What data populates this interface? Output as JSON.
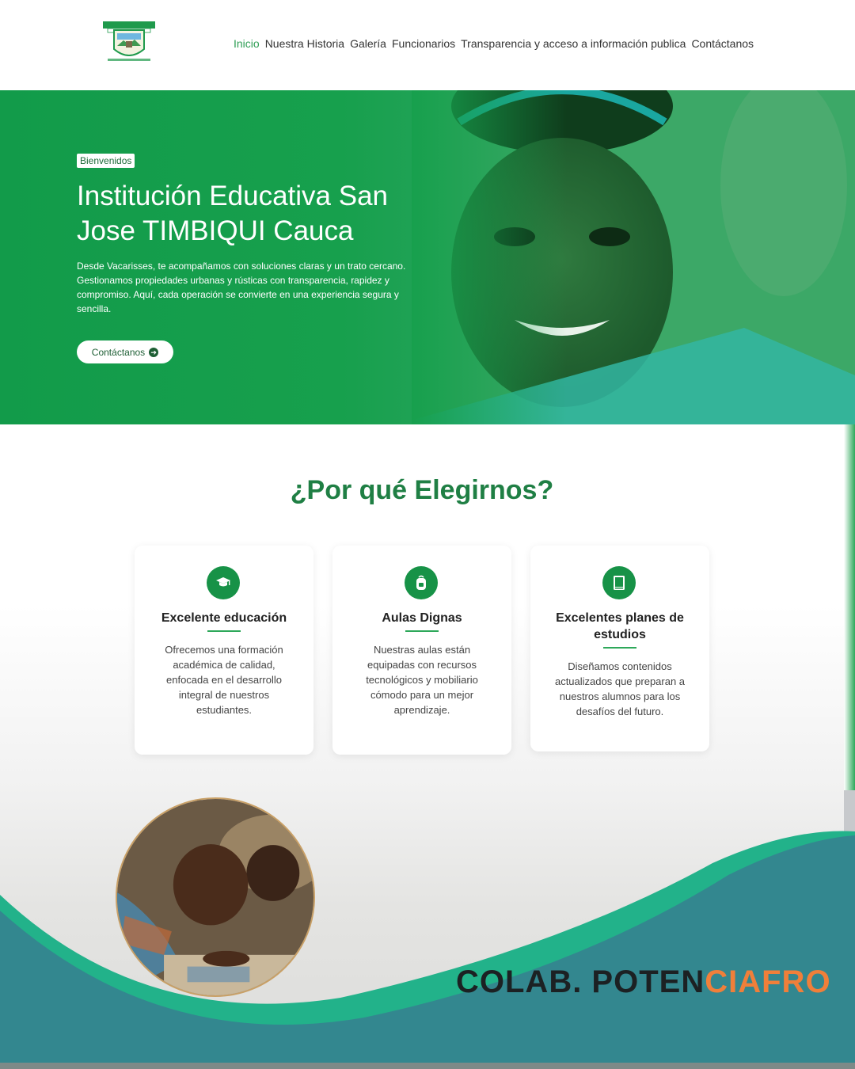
{
  "header": {
    "logo_alt": "Institución Educativa San José Timbiquí Cauca logo",
    "nav": [
      {
        "label": "Inicio",
        "active": true
      },
      {
        "label": "Nuestra Historia",
        "active": false
      },
      {
        "label": "Galería",
        "active": false
      },
      {
        "label": "Funcionarios",
        "active": false
      },
      {
        "label": "Transparencia y acceso a información publica",
        "active": false
      },
      {
        "label": "Contáctanos",
        "active": false
      }
    ]
  },
  "hero": {
    "badge": "Bienvenidos",
    "title_line1": "Institución Educativa San",
    "title_line2": "Jose TIMBIQUI Cauca",
    "description": "Desde Vacarisses, te acompañamos con soluciones claras y un trato cercano. Gestionamos propiedades urbanas y rústicas con transparencia, rapidez y compromiso. Aquí, cada operación se convierte en una experiencia segura y sencilla.",
    "button_label": "Contáctanos",
    "button_icon": "arrow-right-circle-icon"
  },
  "why": {
    "title": "¿Por qué Elegirnos?",
    "cards": [
      {
        "icon": "graduation-cap-icon",
        "title": "Excelente educación",
        "text": "Ofrecemos una formación académica de calidad, enfocada en el desarrollo integral de nuestros estudiantes."
      },
      {
        "icon": "backpack-icon",
        "title": "Aulas Dignas",
        "text": "Nuestras aulas están equipadas con recursos tecnológicos y mobiliario cómodo para un mejor aprendizaje."
      },
      {
        "icon": "book-icon",
        "title": "Excelentes planes de estudios",
        "text": "Diseñamos contenidos actualizados que preparan a nuestros alumnos para los desafíos del futuro."
      }
    ]
  },
  "brand": {
    "part1": "COLAB. POTEN",
    "part2": "CIAFRO"
  },
  "colors": {
    "primary_green": "#179247",
    "teal": "#33878f",
    "accent_orange": "#f07f3a"
  }
}
